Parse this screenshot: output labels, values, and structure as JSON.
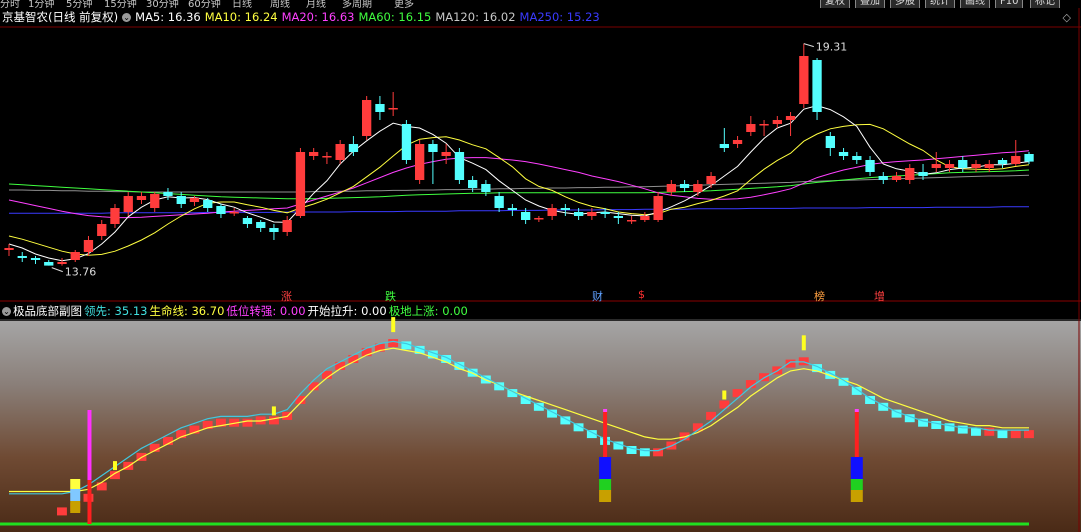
{
  "top_menu": {
    "items": [
      "分时",
      "1分钟",
      "5分钟",
      "15分钟",
      "30分钟",
      "60分钟",
      "日线",
      "周线",
      "月线",
      "多周期",
      "更多"
    ],
    "buttons": [
      "复权",
      "叠加",
      "多股",
      "统计",
      "画线",
      "F10",
      "标记"
    ]
  },
  "main_chart": {
    "stock_title": "京基智农(日线 前复权)",
    "indicators": [
      {
        "label": "MA5: 16.36",
        "color": "#ffffff"
      },
      {
        "label": "MA10: 16.24",
        "color": "#ffff40"
      },
      {
        "label": "MA20: 16.63",
        "color": "#ff40ff"
      },
      {
        "label": "MA60: 16.15",
        "color": "#40ff40"
      },
      {
        "label": "MA120: 16.02",
        "color": "#c8c8c8"
      },
      {
        "label": "MA250: 15.23",
        "color": "#3a3aff"
      }
    ],
    "high_label": "19.31",
    "low_label": "13.76",
    "events": [
      {
        "text": "涨",
        "color": "#ff4040"
      },
      {
        "text": "跌",
        "color": "#40ff40"
      },
      {
        "text": "财",
        "color": "#5fa0ff"
      },
      {
        "text": "$",
        "color": "#ff3030"
      },
      {
        "text": "榜",
        "color": "#ffa040"
      },
      {
        "text": "增",
        "color": "#ff4040"
      }
    ]
  },
  "sub_chart": {
    "title": "极品底部副图",
    "indicators": [
      {
        "label": "领先: 35.13",
        "color": "#40e0e0"
      },
      {
        "label": "生命线: 36.70",
        "color": "#ffff40"
      },
      {
        "label": "低位转强: 0.00",
        "color": "#ff40ff"
      },
      {
        "label": "开始拉升: 0.00",
        "color": "#ffffff"
      },
      {
        "label": "极地上涨: 0.00",
        "color": "#40ff40"
      }
    ]
  },
  "colors": {
    "up": "#ff3c3c",
    "down": "#54ffff",
    "ma5": "#ffffff",
    "ma10": "#ffff40",
    "ma20": "#ff40ff",
    "ma60": "#40ff40",
    "ma250": "#3a3aff"
  },
  "chart_data": {
    "type": "candlestick",
    "ylim": [
      13.0,
      19.8
    ],
    "candles": [
      [
        14.15,
        14.2,
        14.3,
        14.0
      ],
      [
        14.0,
        13.95,
        14.1,
        13.85
      ],
      [
        13.95,
        13.9,
        14.0,
        13.8
      ],
      [
        13.85,
        13.76,
        13.9,
        13.76
      ],
      [
        13.8,
        13.85,
        13.95,
        13.76
      ],
      [
        13.9,
        14.1,
        14.15,
        13.85
      ],
      [
        14.1,
        14.4,
        14.5,
        14.0
      ],
      [
        14.5,
        14.8,
        14.9,
        14.4
      ],
      [
        14.8,
        15.2,
        15.3,
        14.7
      ],
      [
        15.1,
        15.5,
        15.6,
        15.0
      ],
      [
        15.4,
        15.5,
        15.6,
        15.3
      ],
      [
        15.2,
        15.55,
        15.6,
        15.1
      ],
      [
        15.6,
        15.5,
        15.7,
        15.4
      ],
      [
        15.5,
        15.3,
        15.6,
        15.2
      ],
      [
        15.35,
        15.45,
        15.5,
        15.25
      ],
      [
        15.4,
        15.2,
        15.45,
        15.1
      ],
      [
        15.25,
        15.05,
        15.3,
        14.95
      ],
      [
        15.1,
        15.1,
        15.2,
        15.0
      ],
      [
        14.95,
        14.8,
        15.0,
        14.7
      ],
      [
        14.85,
        14.7,
        14.9,
        14.6
      ],
      [
        14.7,
        14.6,
        14.8,
        14.4
      ],
      [
        14.6,
        14.9,
        15.0,
        14.5
      ],
      [
        15.0,
        16.6,
        16.7,
        14.95
      ],
      [
        16.5,
        16.6,
        16.7,
        16.4
      ],
      [
        16.5,
        16.5,
        16.6,
        16.3
      ],
      [
        16.4,
        16.8,
        16.9,
        16.3
      ],
      [
        16.8,
        16.6,
        17.0,
        16.5
      ],
      [
        17.0,
        17.9,
        18.0,
        16.9
      ],
      [
        17.8,
        17.6,
        18.0,
        17.4
      ],
      [
        17.7,
        17.7,
        18.1,
        17.5
      ],
      [
        17.3,
        16.4,
        17.4,
        16.3
      ],
      [
        15.9,
        16.8,
        16.9,
        15.8
      ],
      [
        16.8,
        16.6,
        16.9,
        15.8
      ],
      [
        16.5,
        16.6,
        16.8,
        16.3
      ],
      [
        16.6,
        15.9,
        16.7,
        15.8
      ],
      [
        15.9,
        15.7,
        16.0,
        15.6
      ],
      [
        15.8,
        15.6,
        15.9,
        15.5
      ],
      [
        15.5,
        15.2,
        15.6,
        15.1
      ],
      [
        15.2,
        15.15,
        15.3,
        15.0
      ],
      [
        15.1,
        14.9,
        15.2,
        14.8
      ],
      [
        14.95,
        14.95,
        15.0,
        14.85
      ],
      [
        15.0,
        15.2,
        15.3,
        14.9
      ],
      [
        15.2,
        15.15,
        15.3,
        15.0
      ],
      [
        15.1,
        15.0,
        15.2,
        14.9
      ],
      [
        15.0,
        15.1,
        15.2,
        14.9
      ],
      [
        15.1,
        15.05,
        15.2,
        14.95
      ],
      [
        15.0,
        14.95,
        15.1,
        14.8
      ],
      [
        14.9,
        14.9,
        15.0,
        14.8
      ],
      [
        14.9,
        15.0,
        15.1,
        14.85
      ],
      [
        14.9,
        15.5,
        15.6,
        14.85
      ],
      [
        15.6,
        15.8,
        15.9,
        15.5
      ],
      [
        15.8,
        15.7,
        15.9,
        15.6
      ],
      [
        15.6,
        15.8,
        15.9,
        15.5
      ],
      [
        15.8,
        16.0,
        16.1,
        15.7
      ],
      [
        16.8,
        16.7,
        17.2,
        16.6
      ],
      [
        16.8,
        16.9,
        17.0,
        16.7
      ],
      [
        17.1,
        17.3,
        17.5,
        17.0
      ],
      [
        17.3,
        17.3,
        17.4,
        17.0
      ],
      [
        17.3,
        17.4,
        17.5,
        17.2
      ],
      [
        17.4,
        17.5,
        17.6,
        17.0
      ],
      [
        17.8,
        19.0,
        19.31,
        17.7
      ],
      [
        18.9,
        17.6,
        18.95,
        17.4
      ],
      [
        17.0,
        16.7,
        17.1,
        16.5
      ],
      [
        16.6,
        16.5,
        16.7,
        16.4
      ],
      [
        16.5,
        16.4,
        16.6,
        16.3
      ],
      [
        16.4,
        16.1,
        16.5,
        16.0
      ],
      [
        16.0,
        15.9,
        16.1,
        15.8
      ],
      [
        15.9,
        16.0,
        16.1,
        15.85
      ],
      [
        15.9,
        16.2,
        16.3,
        15.8
      ],
      [
        16.1,
        16.0,
        16.3,
        15.9
      ],
      [
        16.2,
        16.3,
        16.6,
        16.1
      ],
      [
        16.2,
        16.3,
        16.4,
        16.1
      ],
      [
        16.4,
        16.2,
        16.5,
        16.1
      ],
      [
        16.2,
        16.3,
        16.4,
        16.1
      ],
      [
        16.2,
        16.3,
        16.4,
        16.1
      ],
      [
        16.4,
        16.3,
        16.45,
        16.2
      ],
      [
        16.3,
        16.5,
        16.9,
        16.25
      ],
      [
        16.55,
        16.36,
        16.6,
        16.3
      ]
    ],
    "ma5": [
      14.3,
      14.2,
      14.05,
      13.95,
      13.88,
      13.93,
      14.06,
      14.3,
      14.6,
      14.98,
      15.22,
      15.4,
      15.48,
      15.45,
      15.46,
      15.41,
      15.3,
      15.22,
      15.08,
      14.97,
      14.85,
      14.84,
      15.2,
      15.57,
      15.88,
      16.3,
      16.62,
      16.88,
      17.12,
      17.32,
      17.24,
      17.2,
      17.04,
      16.82,
      16.46,
      16.32,
      16.16,
      15.88,
      15.64,
      15.4,
      15.25,
      15.14,
      15.08,
      15.04,
      15.08,
      15.1,
      15.06,
      15.02,
      15.0,
      15.1,
      15.23,
      15.38,
      15.56,
      15.76,
      16.0,
      16.24,
      16.6,
      16.94,
      17.2,
      17.32,
      17.67,
      17.76,
      17.66,
      17.48,
      17.24,
      16.72,
      16.3,
      16.18,
      16.12,
      16.04,
      16.08,
      16.16,
      16.2,
      16.22,
      16.28,
      16.28,
      16.32,
      16.36
    ],
    "ma10": [
      14.5,
      14.42,
      14.32,
      14.22,
      14.12,
      14.05,
      14.02,
      14.04,
      14.12,
      14.25,
      14.4,
      14.58,
      14.8,
      15.0,
      15.18,
      15.32,
      15.35,
      15.35,
      15.28,
      15.22,
      15.14,
      15.08,
      15.2,
      15.3,
      15.42,
      15.58,
      15.74,
      15.98,
      16.22,
      16.5,
      16.77,
      16.92,
      16.96,
      16.98,
      16.9,
      16.78,
      16.68,
      16.46,
      16.23,
      15.93,
      15.74,
      15.64,
      15.48,
      15.34,
      15.24,
      15.18,
      15.1,
      15.06,
      15.03,
      15.06,
      15.17,
      15.22,
      15.31,
      15.39,
      15.5,
      15.63,
      15.91,
      16.17,
      16.39,
      16.57,
      16.87,
      17.05,
      17.18,
      17.24,
      17.28,
      17.29,
      17.18,
      16.99,
      16.8,
      16.64,
      16.4,
      16.23,
      16.18,
      16.17,
      16.16,
      16.18,
      16.24,
      16.28
    ],
    "ma20": [
      15.4,
      15.33,
      15.26,
      15.19,
      15.12,
      15.06,
      15.01,
      14.98,
      14.96,
      14.96,
      14.97,
      14.99,
      15.01,
      15.03,
      15.05,
      15.07,
      15.1,
      15.12,
      15.14,
      15.16,
      15.18,
      15.2,
      15.3,
      15.4,
      15.5,
      15.6,
      15.7,
      15.83,
      15.96,
      16.09,
      16.2,
      16.29,
      16.36,
      16.42,
      16.45,
      16.46,
      16.46,
      16.43,
      16.4,
      16.36,
      16.3,
      16.23,
      16.16,
      16.09,
      16.0,
      15.93,
      15.86,
      15.77,
      15.68,
      15.58,
      15.52,
      15.48,
      15.44,
      15.42,
      15.42,
      15.43,
      15.47,
      15.53,
      15.6,
      15.68,
      15.82,
      15.96,
      16.06,
      16.15,
      16.22,
      16.29,
      16.33,
      16.36,
      16.38,
      16.4,
      16.43,
      16.46,
      16.49,
      16.52,
      16.55,
      16.58,
      16.6,
      16.63
    ],
    "ma60": [
      15.8,
      15.78,
      15.76,
      15.74,
      15.72,
      15.7,
      15.68,
      15.66,
      15.64,
      15.62,
      15.6,
      15.58,
      15.56,
      15.54,
      15.52,
      15.5,
      15.48,
      15.47,
      15.46,
      15.45,
      15.44,
      15.43,
      15.43,
      15.43,
      15.44,
      15.45,
      15.46,
      15.47,
      15.48,
      15.5,
      15.52,
      15.53,
      15.54,
      15.55,
      15.56,
      15.57,
      15.57,
      15.58,
      15.58,
      15.58,
      15.58,
      15.58,
      15.58,
      15.58,
      15.58,
      15.58,
      15.58,
      15.58,
      15.58,
      15.59,
      15.6,
      15.61,
      15.62,
      15.63,
      15.65,
      15.67,
      15.69,
      15.71,
      15.73,
      15.76,
      15.8,
      15.84,
      15.87,
      15.9,
      15.93,
      15.96,
      15.98,
      16.0,
      16.02,
      16.04,
      16.06,
      16.08,
      16.09,
      16.1,
      16.11,
      16.12,
      16.13,
      16.15
    ],
    "ma120": [
      15.65,
      15.65,
      15.64,
      15.64,
      15.63,
      15.63,
      15.62,
      15.62,
      15.61,
      15.61,
      15.6,
      15.6,
      15.6,
      15.6,
      15.6,
      15.6,
      15.6,
      15.6,
      15.6,
      15.6,
      15.6,
      15.6,
      15.6,
      15.61,
      15.61,
      15.62,
      15.62,
      15.63,
      15.63,
      15.64,
      15.64,
      15.65,
      15.65,
      15.66,
      15.66,
      15.67,
      15.67,
      15.68,
      15.68,
      15.69,
      15.69,
      15.7,
      15.7,
      15.71,
      15.71,
      15.72,
      15.72,
      15.73,
      15.73,
      15.74,
      15.75,
      15.76,
      15.77,
      15.78,
      15.79,
      15.8,
      15.81,
      15.82,
      15.83,
      15.84,
      15.86,
      15.87,
      15.88,
      15.89,
      15.9,
      15.91,
      15.92,
      15.93,
      15.94,
      15.95,
      15.96,
      15.97,
      15.98,
      15.99,
      16.0,
      16.0,
      16.01,
      16.02
    ],
    "ma250": [
      15.07,
      15.07,
      15.07,
      15.07,
      15.07,
      15.07,
      15.07,
      15.07,
      15.08,
      15.08,
      15.08,
      15.08,
      15.08,
      15.08,
      15.08,
      15.09,
      15.09,
      15.09,
      15.09,
      15.09,
      15.09,
      15.1,
      15.1,
      15.1,
      15.1,
      15.1,
      15.11,
      15.11,
      15.11,
      15.11,
      15.12,
      15.12,
      15.12,
      15.12,
      15.13,
      15.13,
      15.13,
      15.13,
      15.14,
      15.14,
      15.14,
      15.15,
      15.15,
      15.15,
      15.15,
      15.16,
      15.16,
      15.16,
      15.17,
      15.17,
      15.17,
      15.17,
      15.18,
      15.18,
      15.18,
      15.18,
      15.19,
      15.19,
      15.19,
      15.19,
      15.2,
      15.2,
      15.2,
      15.2,
      15.2,
      15.21,
      15.21,
      15.21,
      15.21,
      15.21,
      15.22,
      15.22,
      15.22,
      15.22,
      15.22,
      15.23,
      15.23,
      15.23
    ],
    "sub_lead": [
      8,
      8,
      8,
      8,
      8,
      9,
      12,
      16,
      20,
      24,
      28,
      31,
      34,
      37,
      39,
      41,
      42,
      42,
      42,
      43,
      43,
      45,
      52,
      58,
      63,
      66,
      69,
      72,
      74,
      75,
      74,
      72,
      70,
      68,
      65,
      62,
      59,
      56,
      53,
      50,
      47,
      44,
      41,
      38,
      35,
      32,
      30,
      28,
      27,
      27,
      29,
      32,
      36,
      40,
      45,
      50,
      55,
      59,
      62,
      66,
      66,
      64,
      61,
      58,
      54,
      50,
      47,
      44,
      42,
      40,
      39,
      38,
      37,
      37,
      36,
      36,
      36,
      36
    ],
    "sub_life": [
      9,
      9,
      9,
      9,
      9,
      9,
      10,
      13,
      17,
      20,
      24,
      27,
      30,
      33,
      35,
      37,
      38,
      39,
      40,
      40,
      41,
      42,
      48,
      54,
      59,
      63,
      66,
      69,
      71,
      72,
      71,
      70,
      68,
      66,
      63,
      61,
      58,
      56,
      53,
      51,
      49,
      47,
      45,
      43,
      41,
      39,
      37,
      35,
      33,
      32,
      32,
      33,
      35,
      38,
      42,
      46,
      51,
      55,
      59,
      62,
      63,
      62,
      60,
      58,
      56,
      53,
      50,
      48,
      46,
      44,
      42,
      40,
      39,
      38,
      38,
      37,
      37,
      37
    ],
    "sub_bars": [
      0,
      0,
      0,
      0,
      2,
      4,
      8,
      13,
      18,
      22,
      26,
      30,
      33,
      36,
      38,
      40,
      41,
      41,
      41,
      42,
      42,
      44,
      51,
      57,
      62,
      66,
      69,
      72,
      74,
      76,
      75,
      73,
      71,
      69,
      66,
      63,
      60,
      57,
      54,
      51,
      48,
      45,
      42,
      39,
      36,
      33,
      31,
      29,
      28,
      28,
      31,
      35,
      39,
      44,
      49,
      54,
      58,
      61,
      64,
      67,
      68,
      65,
      62,
      59,
      55,
      51,
      48,
      45,
      43,
      41,
      40,
      39,
      38,
      37,
      37,
      36,
      36,
      36
    ],
    "sub_signals": [
      5,
      45,
      64,
      94
    ]
  }
}
